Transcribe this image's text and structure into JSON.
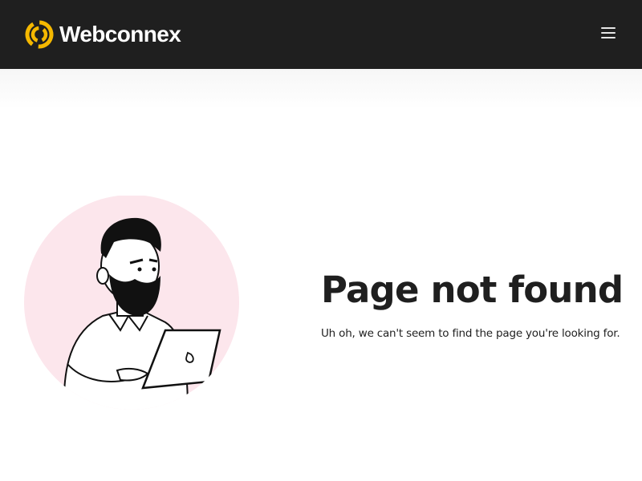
{
  "header": {
    "brand_name": "Webconnex",
    "logo_icon": "webconnex-swirl-icon",
    "menu_icon": "hamburger-menu-icon",
    "background_color": "#1f1f1f",
    "logo_color": "#f5b800"
  },
  "main": {
    "illustration": "bearded-man-with-laptop",
    "illustration_bg_color": "#fce6ec",
    "title": "Page not found",
    "message": "Uh oh, we can't seem to find the page you're looking for."
  }
}
